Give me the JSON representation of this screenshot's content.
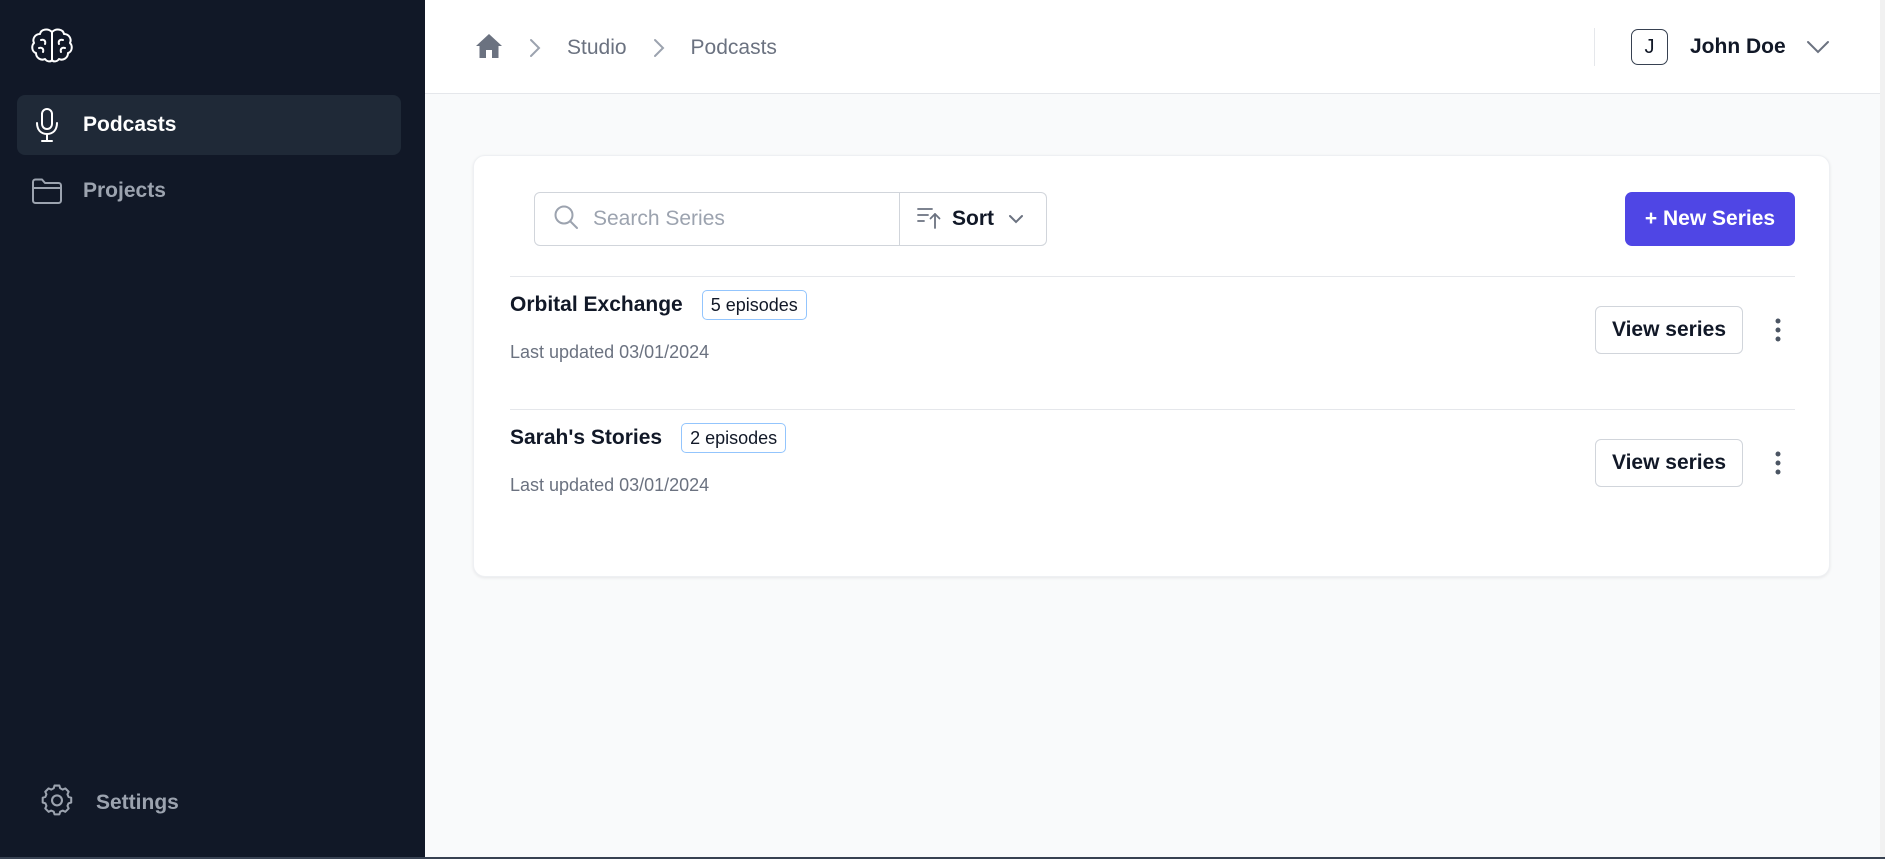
{
  "sidebar": {
    "logo_icon": "brain-icon",
    "items": [
      {
        "label": "Podcasts",
        "icon": "microphone-icon",
        "active": true
      },
      {
        "label": "Projects",
        "icon": "folder-icon",
        "active": false
      }
    ],
    "settings": {
      "label": "Settings",
      "icon": "gear-icon"
    }
  },
  "header": {
    "breadcrumb": [
      {
        "label": "Studio"
      },
      {
        "label": "Podcasts"
      }
    ],
    "user": {
      "initial": "J",
      "name": "John Doe"
    }
  },
  "toolbar": {
    "search_placeholder": "Search Series",
    "search_value": "",
    "sort_label": "Sort",
    "new_button_label": "+ New Series"
  },
  "series": [
    {
      "name": "Orbital Exchange",
      "episodes": "5 episodes",
      "updated": "Last updated 03/01/2024",
      "action": "View series"
    },
    {
      "name": "Sarah's Stories",
      "episodes": "2 episodes",
      "updated": "Last updated 03/01/2024",
      "action": "View series"
    }
  ],
  "colors": {
    "sidebar_bg": "#111827",
    "accent": "#4f46e5",
    "badge_border": "#93c5fd"
  }
}
